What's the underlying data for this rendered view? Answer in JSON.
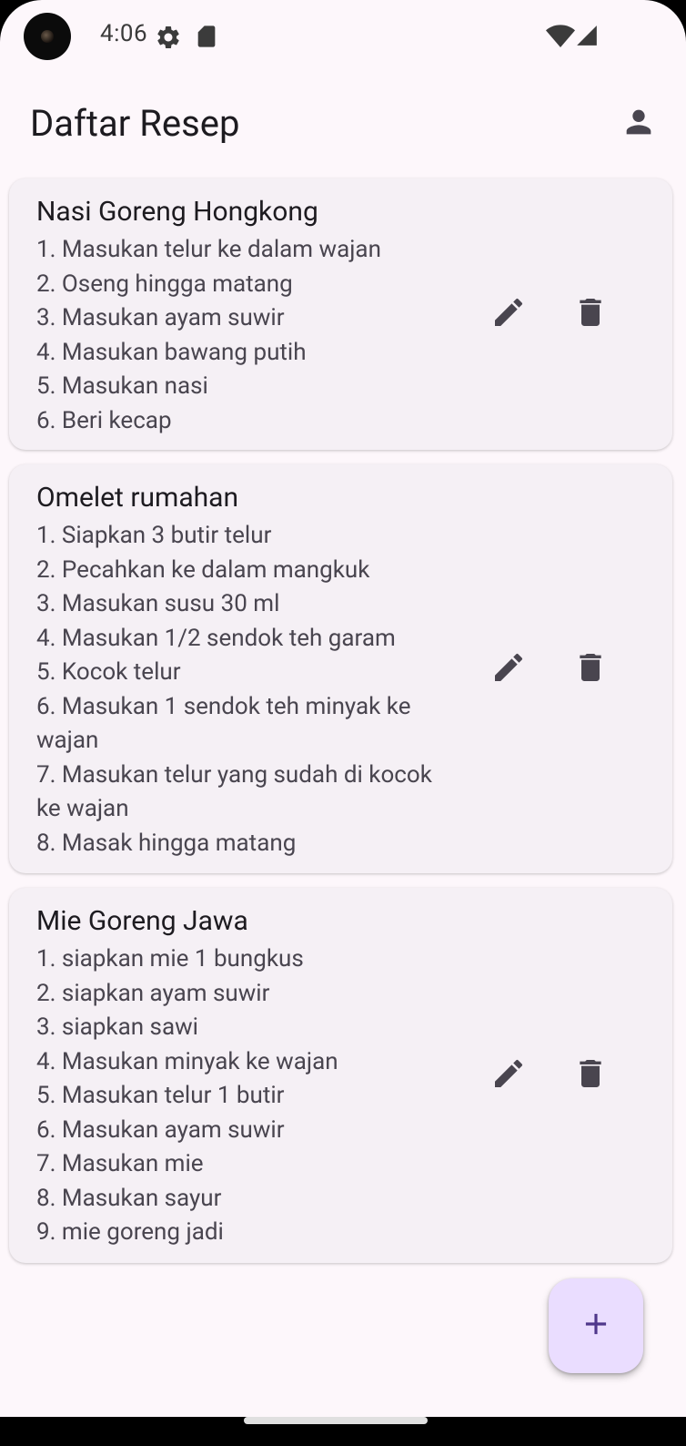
{
  "status_bar": {
    "time": "4:06",
    "icons": [
      "settings-icon",
      "sd-card-icon",
      "wifi-icon",
      "cellular-signal-icon"
    ]
  },
  "app_bar": {
    "title": "Daftar Resep",
    "account_icon": "person-icon"
  },
  "recipes": [
    {
      "title": "Nasi Goreng Hongkong",
      "steps": "1. Masukan telur ke dalam wajan\n2. Oseng hingga matang\n3. Masukan ayam suwir\n4. Masukan bawang putih\n5. Masukan nasi\n6. Beri kecap"
    },
    {
      "title": "Omelet rumahan",
      "steps": "1. Siapkan 3 butir telur\n2. Pecahkan ke dalam mangkuk\n3. Masukan susu 30 ml\n4. Masukan 1/2 sendok teh garam\n5. Kocok telur\n6. Masukan 1 sendok teh minyak ke wajan\n7. Masukan telur yang sudah di kocok ke wajan\n8. Masak hingga matang"
    },
    {
      "title": "Mie Goreng Jawa",
      "steps": "1. siapkan mie 1 bungkus\n2. siapkan ayam suwir\n3. siapkan sawi\n4. Masukan minyak ke wajan\n5. Masukan telur 1 butir\n6. Masukan ayam suwir\n7. Masukan mie\n8. Masukan sayur\n9. mie goreng jadi"
    }
  ],
  "card_actions": {
    "edit_icon": "pencil-icon",
    "delete_icon": "trash-icon"
  },
  "fab": {
    "icon": "plus-icon"
  },
  "colors": {
    "background": "#fdf7fb",
    "card": "#f5f0f5",
    "fab": "#eaddff",
    "fab_icon": "#4f378b",
    "icon": "#49454f"
  }
}
